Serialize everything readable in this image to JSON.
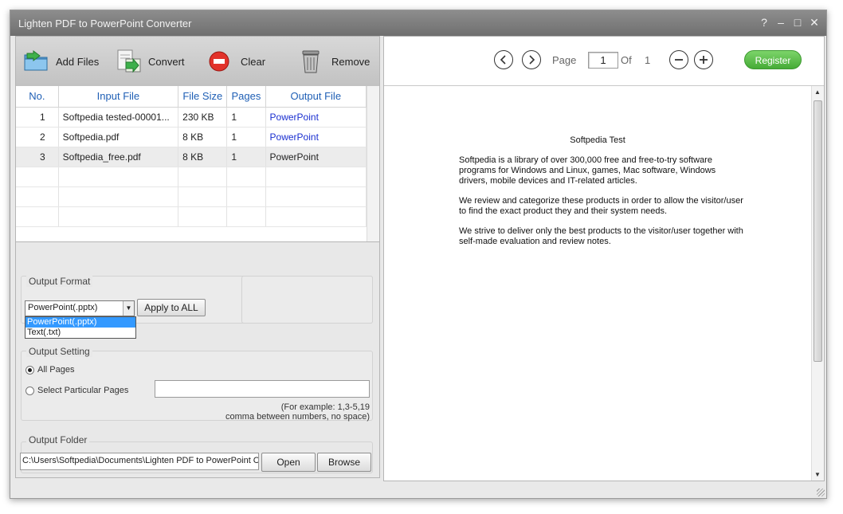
{
  "window": {
    "title": "Lighten PDF to PowerPoint Converter",
    "controls": {
      "help": "?",
      "minimize": "–",
      "maximize": "□",
      "close": "✕"
    }
  },
  "toolbar": {
    "add_files": "Add Files",
    "convert": "Convert",
    "clear": "Clear",
    "remove": "Remove"
  },
  "file_table": {
    "columns": [
      "No.",
      "Input File",
      "File Size",
      "Pages",
      "Output File"
    ],
    "rows": [
      {
        "no": "1",
        "input": "Softpedia tested-00001...",
        "size": "230 KB",
        "pages": "1",
        "output": "PowerPoint"
      },
      {
        "no": "2",
        "input": "Softpedia.pdf",
        "size": "8 KB",
        "pages": "1",
        "output": "PowerPoint"
      },
      {
        "no": "3",
        "input": "Softpedia_free.pdf",
        "size": "8 KB",
        "pages": "1",
        "output": "PowerPoint"
      }
    ]
  },
  "output_format": {
    "label": "Output Format",
    "selected": "PowerPoint(.pptx)",
    "options": [
      "PowerPoint(.pptx)",
      "Text(.txt)"
    ],
    "apply_all": "Apply to ALL"
  },
  "output_setting": {
    "label": "Output Setting",
    "all_pages": "All Pages",
    "particular_pages": "Select Particular Pages",
    "pages_value": "",
    "hint_line1": "(For example: 1,3-5,19",
    "hint_line2": "comma between numbers, no space)"
  },
  "output_folder": {
    "label": "Output Folder",
    "path": "C:\\Users\\Softpedia\\Documents\\Lighten PDF to PowerPoint Co",
    "open": "Open",
    "browse": "Browse"
  },
  "viewer": {
    "page_label": "Page",
    "page_value": "1",
    "of_label": "Of",
    "total_pages": "1",
    "register": "Register"
  },
  "document": {
    "title": "Softpedia Test",
    "para1": "Softpedia is a library of over 300,000 free and free-to-try software programs for Windows and Linux, games, Mac software, Windows drivers, mobile devices and IT-related articles.",
    "para2": "We review and categorize these products in order to allow the visitor/user to find the exact product they and their system needs.",
    "para3": "We strive to deliver only the best products to the visitor/user together with self-made evaluation and review notes."
  },
  "colors": {
    "header_text": "#1f5fb5",
    "link_text": "#1a2fd0",
    "register_green": "#46ab36",
    "selection_blue": "#3399ff"
  }
}
